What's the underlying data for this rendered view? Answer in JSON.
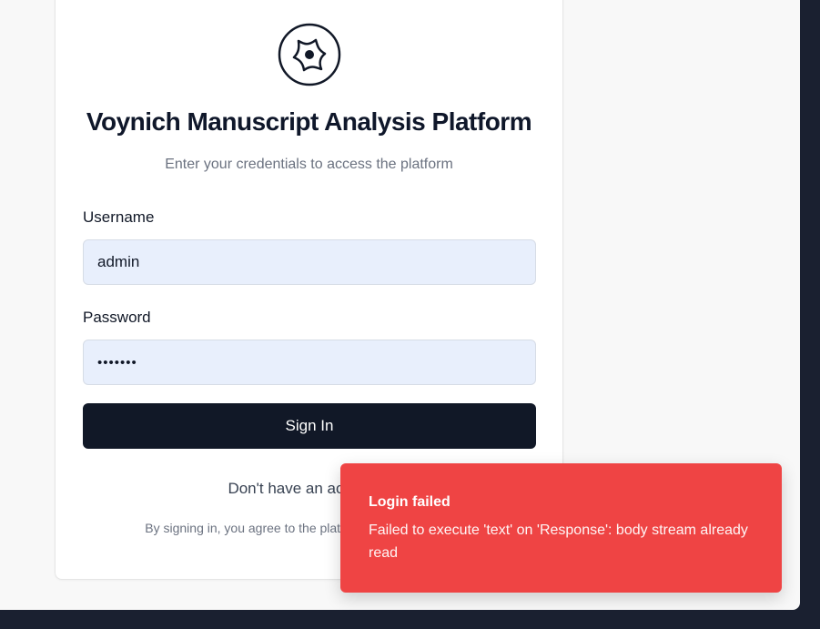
{
  "app": {
    "title": "Voynich Manuscript Analysis Platform",
    "subtitle": "Enter your credentials to access the platform"
  },
  "form": {
    "username_label": "Username",
    "username_value": "admin",
    "password_label": "Password",
    "password_value": "•••••••",
    "signin_label": "Sign In",
    "register_text": "Don't have an account?",
    "terms_text": "By signing in, you agree to the platform's usage guidelines"
  },
  "toast": {
    "title": "Login failed",
    "message": "Failed to execute 'text' on 'Response': body stream already read"
  },
  "icons": {
    "logo": "platform-logo-icon"
  },
  "colors": {
    "primary": "#111827",
    "input_bg": "#e8effc",
    "error": "#ef4444",
    "muted": "#6b7280"
  }
}
